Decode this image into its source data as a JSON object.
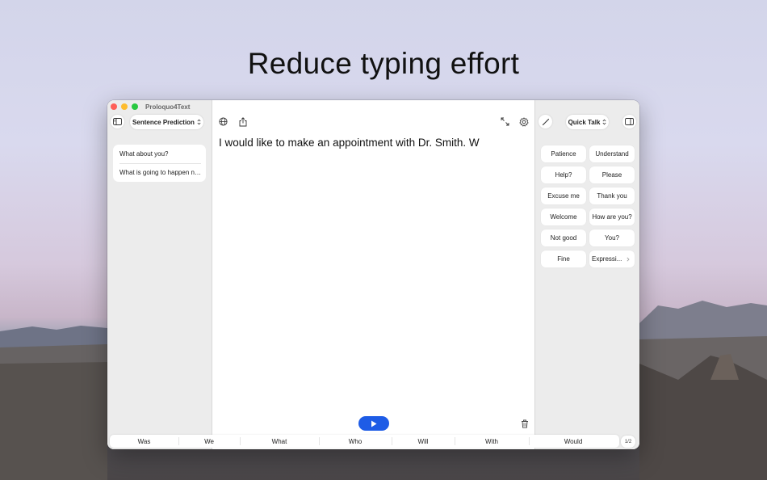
{
  "headline": "Reduce typing effort",
  "window": {
    "title": "Proloquo4Text"
  },
  "left_sidebar": {
    "mode_label": "Sentence Prediction",
    "predictions": [
      "What about you?",
      "What is going to happen ne..."
    ]
  },
  "editor": {
    "text": "I would like to make an appointment with Dr.  Smith.  W"
  },
  "right_sidebar": {
    "mode_label": "Quick Talk",
    "phrases": [
      "Patience",
      "Understand",
      "Help?",
      "Please",
      "Excuse me",
      "Thank you",
      "Welcome",
      "How are you?",
      "Not good",
      "You?",
      "Fine",
      "Expressi..."
    ]
  },
  "word_predictions": [
    "Was",
    "We",
    "What",
    "Who",
    "Will",
    "With",
    "Would"
  ],
  "fraction_label": "1/2",
  "icons": {
    "sidebar_left": "sidebar-left-icon",
    "globe": "globe-icon",
    "share": "share-icon",
    "expand": "expand-icon",
    "settings": "gear-icon",
    "pen": "pen-icon",
    "sidebar_right": "sidebar-right-icon",
    "play": "play-icon",
    "trash": "trash-icon"
  },
  "colors": {
    "accent": "#1e5ce6",
    "close": "#fe5f57",
    "minimize": "#febc2e",
    "zoom": "#28c840"
  }
}
